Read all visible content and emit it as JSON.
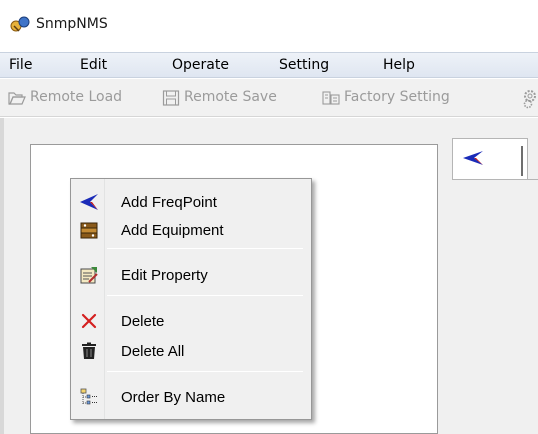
{
  "window": {
    "title": "SnmpNMS"
  },
  "menubar": {
    "items": [
      {
        "label": "File"
      },
      {
        "label": "Edit"
      },
      {
        "label": "Operate"
      },
      {
        "label": "Setting"
      },
      {
        "label": "Help"
      }
    ]
  },
  "toolbar": {
    "buttons": [
      {
        "label": "Remote Load",
        "icon": "folder-open-icon",
        "enabled": false
      },
      {
        "label": "Remote Save",
        "icon": "floppy-disk-icon",
        "enabled": false
      },
      {
        "label": "Factory Setting",
        "icon": "factory-setting-icon",
        "enabled": false
      }
    ],
    "overflow_icon": "settings-gears-icon"
  },
  "tabs": {
    "icon": "freqpoint-arrow-icon"
  },
  "context_menu": {
    "items": [
      {
        "label": "Add FreqPoint",
        "icon": "freqpoint-arrow-icon"
      },
      {
        "label": "Add Equipment",
        "icon": "equipment-icon"
      },
      {
        "label": "Edit Property",
        "icon": "edit-property-icon"
      },
      {
        "label": "Delete",
        "icon": "delete-x-icon"
      },
      {
        "label": "Delete All",
        "icon": "trash-can-icon"
      },
      {
        "label": "Order By Name",
        "icon": "order-by-name-icon"
      }
    ]
  },
  "colors": {
    "menubar_bg": "#dfe6f1",
    "toolbar_disabled_text": "#9b9b9b",
    "arrow_blue": "#1a2bb8",
    "delete_red": "#d42020"
  }
}
